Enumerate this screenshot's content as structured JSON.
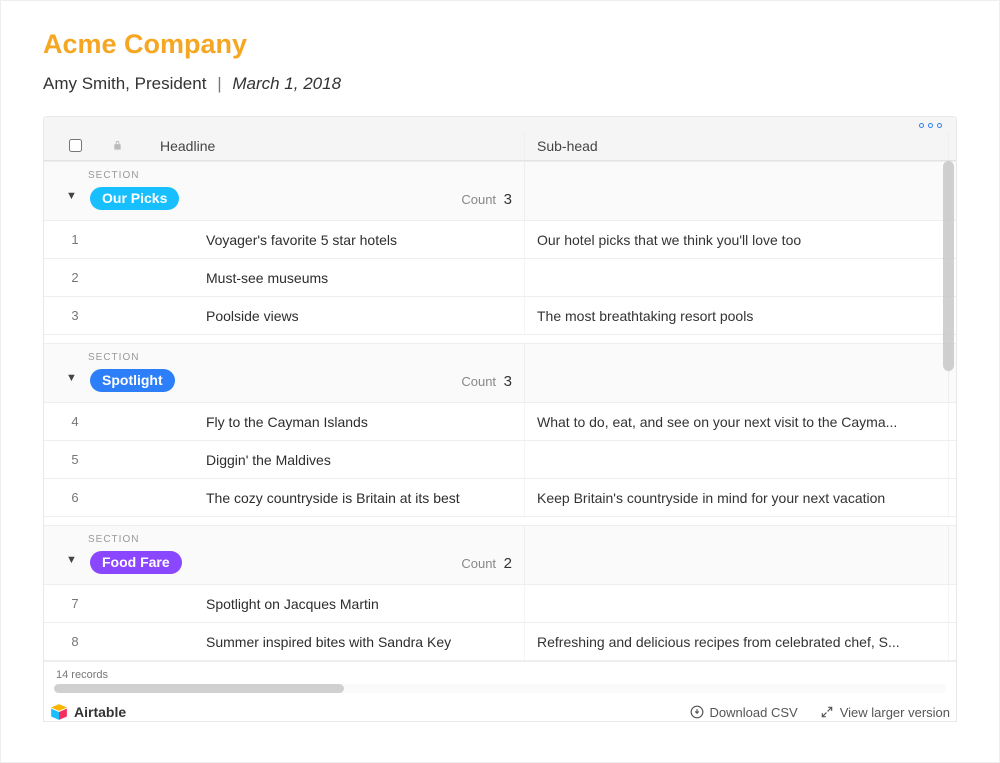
{
  "header": {
    "company": "Acme Company",
    "author": "Amy Smith, President",
    "separator": "|",
    "date": "March 1, 2018"
  },
  "columns": {
    "headline": "Headline",
    "subhead": "Sub-head",
    "section": "Section"
  },
  "group_label": "SECTION",
  "count_label": "Count",
  "groups": [
    {
      "name": "Our Picks",
      "color": "cyan",
      "tag_display": "Our P",
      "count": "3",
      "rows": [
        {
          "num": "1",
          "headline": "Voyager's favorite 5 star hotels",
          "subhead": "Our hotel picks that we think you'll love too"
        },
        {
          "num": "2",
          "headline": "Must-see museums",
          "subhead": ""
        },
        {
          "num": "3",
          "headline": "Poolside views",
          "subhead": "The most breathtaking resort pools"
        }
      ]
    },
    {
      "name": "Spotlight",
      "color": "blue",
      "tag_display": "Spotli",
      "count": "3",
      "rows": [
        {
          "num": "4",
          "headline": "Fly to the Cayman Islands",
          "subhead": "What to do, eat, and see on your next visit to the Cayma..."
        },
        {
          "num": "5",
          "headline": "Diggin' the Maldives",
          "subhead": ""
        },
        {
          "num": "6",
          "headline": "The cozy countryside is Britain at its best",
          "subhead": "Keep Britain's countryside in mind for your next vacation"
        }
      ]
    },
    {
      "name": "Food Fare",
      "color": "purple",
      "tag_display": "Food",
      "count": "2",
      "rows": [
        {
          "num": "7",
          "headline": "Spotlight on Jacques Martin",
          "subhead": ""
        },
        {
          "num": "8",
          "headline": "Summer inspired bites with Sandra Key",
          "subhead": "Refreshing and delicious recipes from celebrated chef, S..."
        }
      ]
    }
  ],
  "footer": {
    "records": "14 records",
    "brand": "Airtable",
    "download": "Download CSV",
    "larger": "View larger version"
  }
}
